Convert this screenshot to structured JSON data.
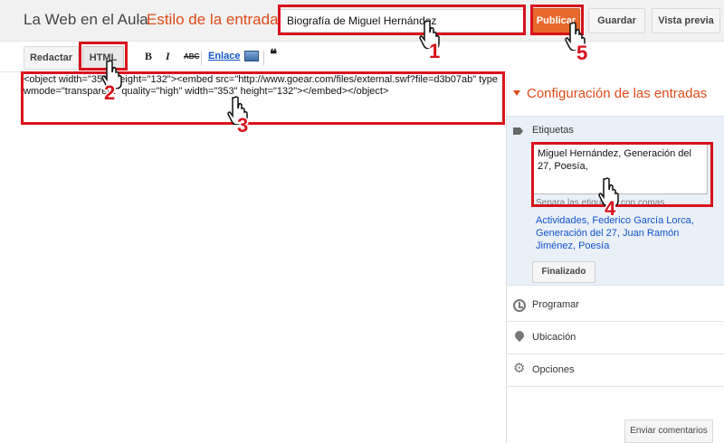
{
  "header": {
    "blog_title": "La Web en el Aula",
    "separator": "·",
    "post_subtitle": "Estilo de la entrada",
    "title_value": "Biografía de Miguel Hernández",
    "publish_label": "Publicar",
    "save_label": "Guardar",
    "preview_label": "Vista previa"
  },
  "toolbar": {
    "compose_label": "Redactar",
    "html_label": "HTML",
    "bold": "B",
    "italic": "I",
    "strikethrough": "ABC",
    "link_label": "Enlace",
    "quote": "❝"
  },
  "editor": {
    "line1": "<object width=\"353\" height=\"132\"><embed src=\"http://www.goear.com/files/external.swf?file=d3b07ab\" type",
    "line2": "wmode=\"transparent\" quality=\"high\" width=\"353\" height=\"132\"></embed></object>"
  },
  "sidebar": {
    "settings_title": "Configuración de las entradas",
    "labels_title": "Etiquetas",
    "labels_value": "Miguel Hernández, Generación del 27, Poesía,",
    "labels_hint": "Separa las etiquetas con comas.",
    "suggestions": "Actividades, Federico García Lorca, Generación del 27, Juan Ramón Jiménez, Poesía",
    "done_label": "Finalizado",
    "schedule_label": "Programar",
    "location_label": "Ubicación",
    "options_label": "Opciones"
  },
  "footer": {
    "comments_label": "Enviar comentarios"
  },
  "annotations": {
    "step1": "1",
    "step2": "2",
    "step3": "3",
    "step4": "4",
    "step5": "5",
    "highlight_color": "#d8121b"
  },
  "colors": {
    "accent": "#dd4b1a",
    "publish_button": "#e9692c",
    "link": "#1155cc"
  },
  "icons": {
    "tag": "tag-icon",
    "schedule": "clock-icon",
    "location": "map-pin-icon",
    "options": "gear-icon",
    "pointer": "hand-pointer-icon"
  }
}
